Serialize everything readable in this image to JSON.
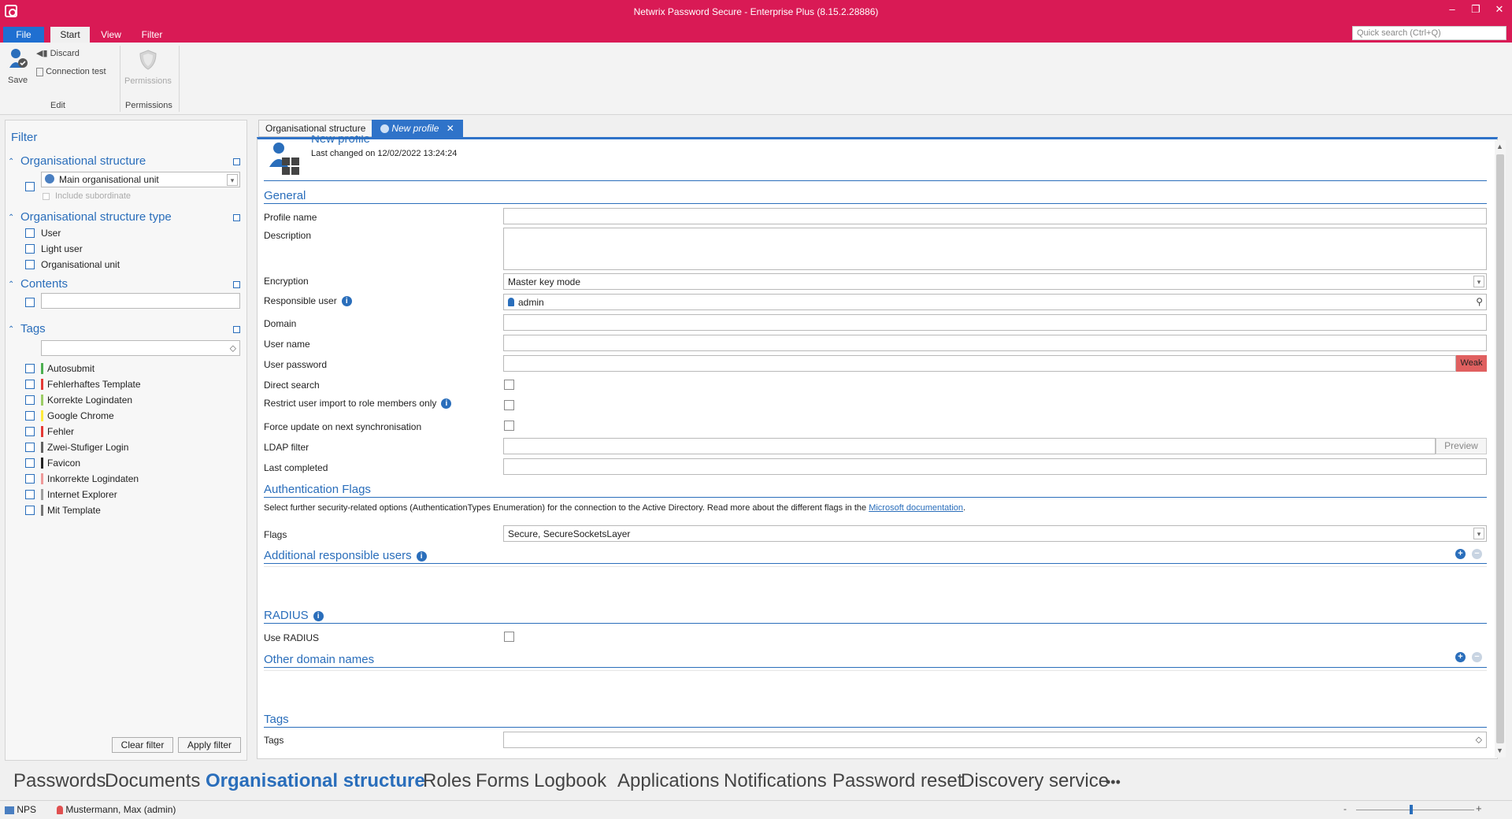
{
  "app": {
    "title": "Netwrix Password Secure - Enterprise Plus (8.15.2.28886)"
  },
  "menu": {
    "file": "File",
    "start": "Start",
    "view": "View",
    "filter": "Filter"
  },
  "quick_search": {
    "placeholder": "Quick search (Ctrl+Q)"
  },
  "ribbon": {
    "save": "Save",
    "discard": "Discard",
    "connection_test": "Connection test",
    "group_edit": "Edit",
    "permissions": "Permissions",
    "group_permissions": "Permissions"
  },
  "filter": {
    "title": "Filter",
    "org_structure": {
      "header": "Organisational structure",
      "selected": "Main organisational unit",
      "include_subordinate": "Include subordinate"
    },
    "org_type": {
      "header": "Organisational structure type",
      "options": [
        "User",
        "Light user",
        "Organisational unit"
      ]
    },
    "contents": {
      "header": "Contents"
    },
    "tags": {
      "header": "Tags",
      "items": [
        {
          "label": "Autosubmit",
          "color": "#4caf50"
        },
        {
          "label": "Fehlerhaftes Template",
          "color": "#e53935"
        },
        {
          "label": "Korrekte Logindaten",
          "color": "#9ccc65"
        },
        {
          "label": "Google Chrome",
          "color": "#ffeb3b"
        },
        {
          "label": "Fehler",
          "color": "#e53935"
        },
        {
          "label": "Zwei-Stufiger Login",
          "color": "#616161"
        },
        {
          "label": "Favicon",
          "color": "#212121"
        },
        {
          "label": "Inkorrekte Logindaten",
          "color": "#ef9a9a"
        },
        {
          "label": "Internet Explorer",
          "color": "#9e9e9e"
        },
        {
          "label": "Mit Template",
          "color": "#757575"
        }
      ]
    },
    "clear": "Clear filter",
    "apply": "Apply filter"
  },
  "doc_tabs": {
    "tab1": "Organisational structure",
    "tab2": "New profile"
  },
  "profile": {
    "title": "New profile",
    "last_changed": "Last changed on 12/02/2022 13:24:24",
    "general": "General",
    "profile_name": "Profile name",
    "description": "Description",
    "encryption": "Encryption",
    "encryption_value": "Master key mode",
    "responsible_user": "Responsible user",
    "responsible_user_value": "admin",
    "domain": "Domain",
    "user_name": "User name",
    "user_password": "User password",
    "password_strength": "Weak",
    "direct_search": "Direct search",
    "restrict_import": "Restrict user import to role members only",
    "force_update": "Force update on next synchronisation",
    "ldap_filter": "LDAP filter",
    "preview": "Preview",
    "last_completed": "Last completed",
    "auth_flags": "Authentication Flags",
    "auth_desc": "Select further security-related options (AuthenticationTypes Enumeration) for the connection to the Active Directory. Read more about the different flags in the",
    "auth_link": "Microsoft documentation",
    "flags": "Flags",
    "flags_value": "Secure, SecureSocketsLayer",
    "additional_users": "Additional responsible users",
    "radius": "RADIUS",
    "use_radius": "Use RADIUS",
    "other_domains": "Other domain names",
    "tags_section": "Tags",
    "tags_label": "Tags"
  },
  "bottom_nav": [
    "Passwords",
    "Documents",
    "Organisational structure",
    "Roles",
    "Forms",
    "Logbook",
    "Applications",
    "Notifications",
    "Password reset",
    "Discovery service"
  ],
  "bottom_nav_more": "•••",
  "status": {
    "db": "NPS",
    "user": "Mustermann, Max (admin)"
  },
  "colors": {
    "brand": "#d91a55",
    "accent": "#2a6ebb",
    "weak": "#e06060"
  }
}
